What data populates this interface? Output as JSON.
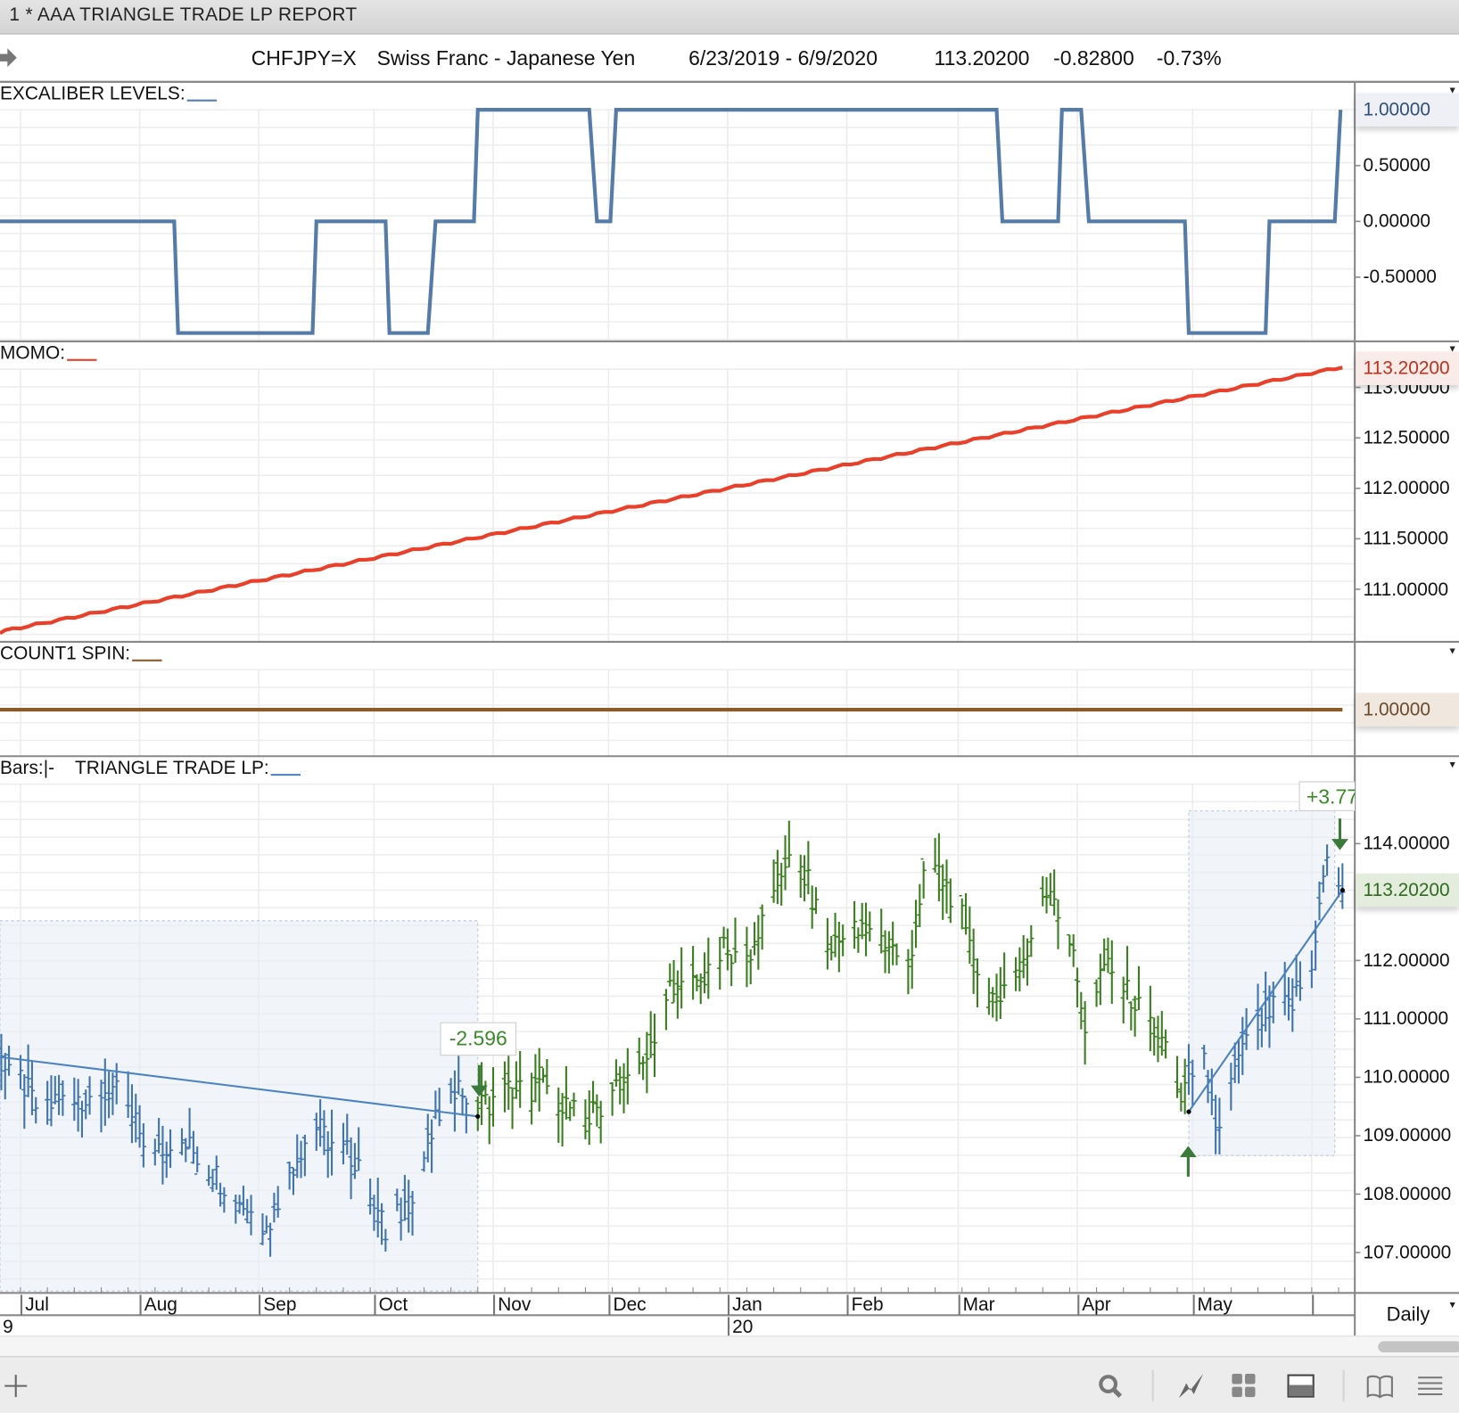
{
  "window": {
    "title": "1 * AAA  TRIANGLE TRADE LP  REPORT"
  },
  "header": {
    "symbol": "CHFJPY=X",
    "name": "Swiss Franc - Japanese Yen",
    "range": "6/23/2019 - 6/9/2020",
    "last": "113.20200",
    "change": "-0.82800",
    "percent": "-0.73%"
  },
  "panels": {
    "excaliber": {
      "label": "EXCALIBER LEVELS:",
      "current": "1.00000",
      "ticks": [
        1.0,
        0.5,
        0.0,
        -0.5
      ]
    },
    "momo": {
      "label": "MOMO:",
      "current": "113.20200",
      "ticks": [
        113.0,
        112.5,
        112.0,
        111.5,
        111.0
      ]
    },
    "count1": {
      "label": "COUNT1 SPIN:",
      "current": "1.00000"
    },
    "price": {
      "bars_label": "Bars:",
      "bars_symbol": "|-",
      "label": "TRIANGLE TRADE LP:",
      "current": "113.20200",
      "ticks": [
        114,
        112,
        111,
        110,
        109,
        108,
        107
      ],
      "trade1_label": "-2.596",
      "trade2_label": "+3.77"
    }
  },
  "xaxis": {
    "months": [
      {
        "label": "Jul",
        "day": 8
      },
      {
        "label": "Aug",
        "day": 39
      },
      {
        "label": "Sep",
        "day": 70
      },
      {
        "label": "Oct",
        "day": 100
      },
      {
        "label": "Nov",
        "day": 131
      },
      {
        "label": "Dec",
        "day": 161
      },
      {
        "label": "Jan",
        "day": 192
      },
      {
        "label": "Feb",
        "day": 223
      },
      {
        "label": "Mar",
        "day": 252
      },
      {
        "label": "Apr",
        "day": 283
      },
      {
        "label": "May",
        "day": 313
      },
      {
        "label": "",
        "day": 344
      }
    ],
    "years": [
      {
        "label": "9",
        "day": 0
      },
      {
        "label": "20",
        "day": 192
      }
    ]
  },
  "interval": "Daily",
  "toolbar": {
    "icons": [
      "add-icon",
      "search-icon",
      "chart-style-icon",
      "layout-grid-icon",
      "panel-icon",
      "book-icon",
      "menu-icon"
    ]
  },
  "colors": {
    "excaliber": "#557ba8",
    "momo": "#e8402a",
    "count1": "#8a5a2b",
    "bars_up_region": "#3f74ad",
    "bars_mid": "#3a7f1f",
    "trade_line": "#4b82c0",
    "arrow": "#3b7a3b"
  },
  "chart_data": [
    {
      "type": "line",
      "title": "EXCALIBER LEVELS",
      "x_unit": "days since 6/23/2019",
      "ylim": [
        -1,
        1
      ],
      "points": [
        [
          0,
          0
        ],
        [
          48,
          0
        ],
        [
          49,
          -1
        ],
        [
          84,
          -1
        ],
        [
          85,
          0
        ],
        [
          103,
          0
        ],
        [
          104,
          -1
        ],
        [
          114,
          -1
        ],
        [
          116,
          0
        ],
        [
          126,
          0
        ],
        [
          127,
          1
        ],
        [
          156,
          1
        ],
        [
          158,
          0
        ],
        [
          161.5,
          0
        ],
        [
          163,
          1
        ],
        [
          262,
          1
        ],
        [
          263.5,
          0
        ],
        [
          278,
          0
        ],
        [
          279,
          1
        ],
        [
          284,
          1
        ],
        [
          286,
          0
        ],
        [
          311,
          0
        ],
        [
          312,
          -1
        ],
        [
          332,
          -1
        ],
        [
          333,
          0
        ],
        [
          350,
          0
        ],
        [
          351.5,
          1
        ]
      ]
    },
    {
      "type": "line",
      "title": "MOMO",
      "x_unit": "days since 6/23/2019",
      "ylim": [
        110.5,
        113.3
      ],
      "points": [
        [
          0,
          110.56
        ],
        [
          352,
          113.202
        ]
      ]
    },
    {
      "type": "line",
      "title": "COUNT1 SPIN",
      "x_unit": "days since 6/23/2019",
      "points": [
        [
          0,
          1.0
        ],
        [
          352,
          1.0
        ]
      ]
    },
    {
      "type": "bar-ohlc",
      "title": "CHFJPY=X Daily",
      "x_unit": "days since 6/23/2019",
      "ylim": [
        106.7,
        114.8
      ],
      "close_path": [
        [
          5,
          110.3
        ],
        [
          12,
          109.5
        ],
        [
          22,
          109.65
        ],
        [
          32,
          109.8
        ],
        [
          41,
          108.85
        ],
        [
          51,
          108.85
        ],
        [
          63,
          108.05
        ],
        [
          72,
          107.4
        ],
        [
          78,
          108.4
        ],
        [
          84,
          109.2
        ],
        [
          90,
          108.8
        ],
        [
          97,
          108.55
        ],
        [
          103,
          107.3
        ],
        [
          109,
          107.9
        ],
        [
          115,
          109.0
        ],
        [
          120,
          109.95
        ],
        [
          127,
          109.5
        ],
        [
          136,
          109.8
        ],
        [
          146,
          109.8
        ],
        [
          155,
          109.2
        ],
        [
          162,
          109.8
        ],
        [
          170,
          110.1
        ],
        [
          176,
          111.4
        ],
        [
          184,
          111.55
        ],
        [
          190,
          112.2
        ],
        [
          196,
          111.9
        ],
        [
          204,
          113.0
        ],
        [
          208,
          113.95
        ],
        [
          213,
          113.3
        ],
        [
          218,
          112.2
        ],
        [
          225,
          112.5
        ],
        [
          233,
          112.35
        ],
        [
          239,
          111.9
        ],
        [
          244,
          113.8
        ],
        [
          250,
          113.15
        ],
        [
          255,
          112.5
        ],
        [
          259,
          110.9
        ],
        [
          264,
          111.7
        ],
        [
          269,
          112.0
        ],
        [
          276,
          113.3
        ],
        [
          281,
          112.35
        ],
        [
          285,
          110.9
        ],
        [
          291,
          112.0
        ],
        [
          298,
          111.25
        ],
        [
          304,
          110.75
        ],
        [
          310,
          109.65
        ],
        [
          315,
          110.6
        ],
        [
          319,
          109.0
        ],
        [
          325,
          110.3
        ],
        [
          332,
          111.1
        ],
        [
          339,
          111.25
        ],
        [
          344,
          112.0
        ],
        [
          348,
          113.8
        ],
        [
          352,
          113.202
        ]
      ],
      "trades": [
        {
          "label": "-2.596",
          "start": [
            0,
            110.37
          ],
          "end": [
            127,
            109.33
          ],
          "region_high": 112.68,
          "exit": "down-arrow"
        },
        {
          "label": "+3.77",
          "start": [
            312,
            109.41
          ],
          "end": [
            352,
            113.202
          ],
          "region_high": 114.56,
          "region_low": 108.66,
          "entry": "up-arrow",
          "exit": "down-arrow"
        }
      ]
    }
  ]
}
